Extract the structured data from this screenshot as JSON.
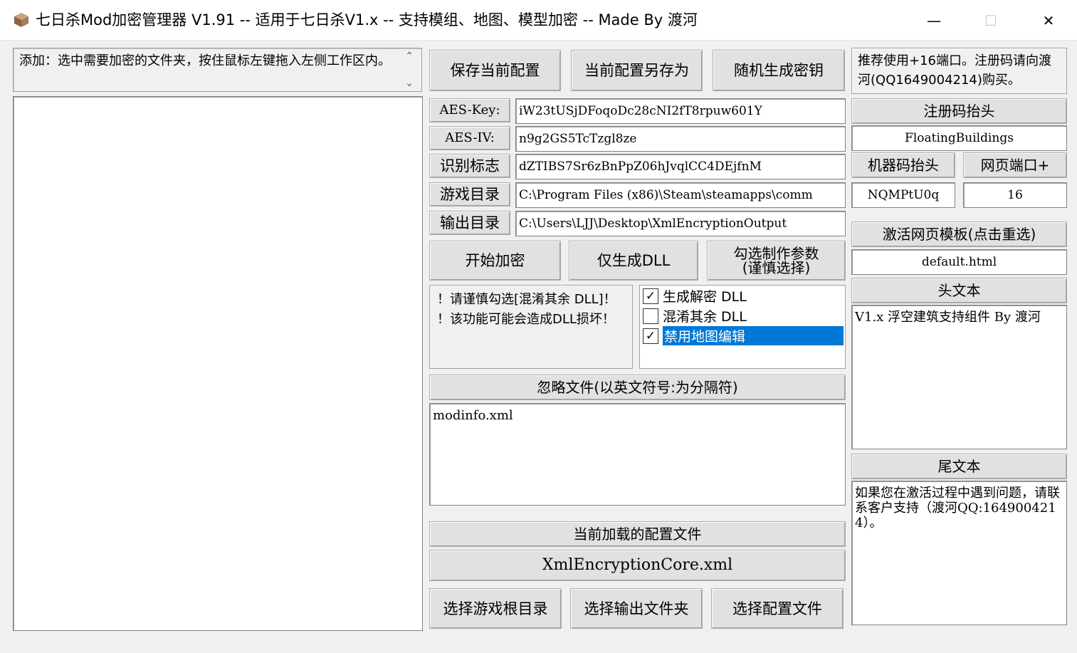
{
  "window": {
    "title": "七日杀Mod加密管理器 V1.91   --   适用于七日杀V1.x   --   支持模组、地图、模型加密   --   Made By 渡河",
    "minimize_glyph": "—",
    "maximize_glyph": "☐",
    "close_glyph": "✕"
  },
  "hint": {
    "text": "添加：选中需要加密的文件夹，按住鼠标左键拖入左侧工作区内。",
    "scroll_up": "⌃",
    "scroll_down": "⌄"
  },
  "toolbar": {
    "save_config": "保存当前配置",
    "save_as": "当前配置另存为",
    "random_key": "随机生成密钥"
  },
  "params": {
    "aes_key_label": "AES-Key:",
    "aes_key_value": "iW23tUSjDFoqoDc28cNI2fT8rpuw601Y",
    "aes_iv_label": "AES-IV:",
    "aes_iv_value": "n9g2GS5TcTzgl8ze",
    "id_label": "识别标志",
    "id_value": "dZTIBS7Sr6zBnPpZ06hJvqlCC4DEjfnM",
    "game_dir_label": "游戏目录",
    "game_dir_value": "C:\\Program Files (x86)\\Steam\\steamapps\\comm",
    "output_dir_label": "输出目录",
    "output_dir_value": "C:\\Users\\LJJ\\Desktop\\XmlEncryptionOutput"
  },
  "actions": {
    "start_encrypt": "开始加密",
    "only_dll": "仅生成DLL",
    "select_params_line1": "勾选制作参数",
    "select_params_line2": "(谨慎选择)"
  },
  "warning": {
    "line1": "！请谨慎勾选[混淆其余 DLL]！",
    "line2": "！该功能可能会造成DLL损坏！"
  },
  "options": [
    {
      "label": "生成解密 DLL",
      "checked": true,
      "check_glyph": "✓"
    },
    {
      "label": "混淆其余 DLL",
      "checked": false,
      "check_glyph": ""
    },
    {
      "label": "禁用地图编辑",
      "checked": true,
      "check_glyph": "✓"
    }
  ],
  "ignore": {
    "header": "忽略文件(以英文符号:为分隔符)",
    "value": "modinfo.xml"
  },
  "config": {
    "header": "当前加载的配置文件",
    "value": "XmlEncryptionCore.xml"
  },
  "bottom": {
    "select_game_root": "选择游戏根目录",
    "select_output": "选择输出文件夹",
    "select_config": "选择配置文件"
  },
  "right": {
    "notice": "推荐使用+16端口。注册码请向渡河(QQ1649004214)购买。",
    "reg_header": "注册码抬头",
    "reg_value": "FloatingBuildings",
    "machine_header": "机器码抬头",
    "port_label": "网页端口+",
    "machine_value": "NQMPtU0q",
    "port_value": "16",
    "template_header": "激活网页模板(点击重选)",
    "template_value": "default.html",
    "head_text_header": "头文本",
    "head_text_value": "V1.x 浮空建筑支持组件 By 渡河",
    "tail_text_header": "尾文本",
    "tail_text_value": "如果您在激活过程中遇到问题，请联系客户支持（渡河QQ:1649004214）。"
  }
}
